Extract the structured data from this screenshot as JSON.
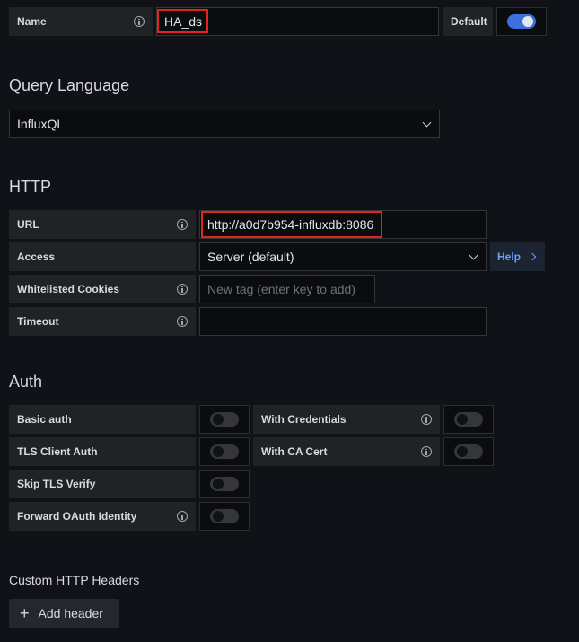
{
  "name_row": {
    "label": "Name",
    "value": "HA_ds",
    "default_label": "Default",
    "default_enabled": true
  },
  "query_language": {
    "title": "Query Language",
    "selected": "InfluxQL"
  },
  "http": {
    "title": "HTTP",
    "url_label": "URL",
    "url_value": "http://a0d7b954-influxdb:8086",
    "access_label": "Access",
    "access_value": "Server (default)",
    "help_label": "Help",
    "cookies_label": "Whitelisted Cookies",
    "cookies_placeholder": "New tag (enter key to add)",
    "timeout_label": "Timeout",
    "timeout_value": ""
  },
  "auth": {
    "title": "Auth",
    "basic_auth": "Basic auth",
    "with_credentials": "With Credentials",
    "tls_client_auth": "TLS Client Auth",
    "with_ca_cert": "With CA Cert",
    "skip_tls_verify": "Skip TLS Verify",
    "forward_oauth": "Forward OAuth Identity"
  },
  "custom_headers": {
    "title": "Custom HTTP Headers",
    "add_label": "Add header"
  },
  "colors": {
    "accent": "#3d71d9",
    "highlight_border": "#e1251b",
    "background": "#111217"
  }
}
